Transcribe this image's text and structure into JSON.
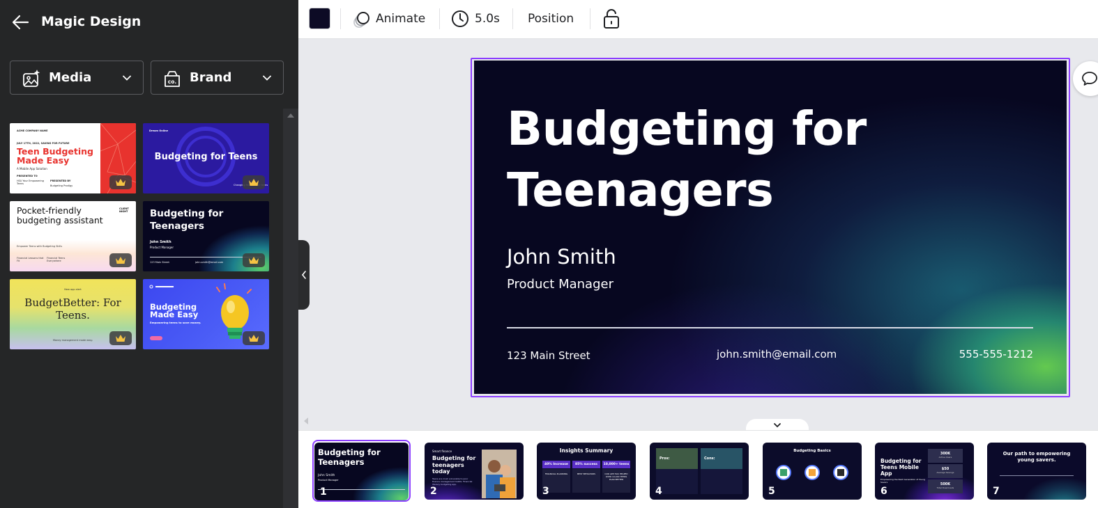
{
  "panel": {
    "title": "Magic Design",
    "filters": {
      "media_label": "Media",
      "brand_label": "Brand",
      "brand_logo_text": "co."
    }
  },
  "templates": [
    {
      "id": "t1",
      "small_top": "ACME COMPANY NAME",
      "date": "JULY 17TH, 2022, SAVING FOR FUTURE",
      "title": "Teen Budgeting Made Easy",
      "subtitle": "A Mobile App Solution",
      "presented_to_label": "PRESENTED TO",
      "presented_to": "HSU Your Empowering Teens",
      "presented_by_label": "PRESENTED BY",
      "presented_by": "Budgeting Prodigy"
    },
    {
      "id": "t2",
      "small_top": "Dream Online",
      "title": "Budgeting for Teens",
      "footer": "Changing finances for teens"
    },
    {
      "id": "t3",
      "title": "Pocket-friendly budgeting assistant",
      "corner": "CLIENT NIGHT",
      "tagline": "Empower Teens with Budgeting Skills",
      "col1_label": "Financial Lessons that Fit",
      "col2_label": "Financial Teens Everywhere"
    },
    {
      "id": "t4",
      "title": "Budgeting for Teenagers",
      "name": "John Smith",
      "role": "Product Manager",
      "addr": "123 Main Street",
      "mail": "john.smith@email.com"
    },
    {
      "id": "t5",
      "small_top": "New app alert",
      "title": "BudgetBetter: For Teens.",
      "footer": "Money management made easy."
    },
    {
      "id": "t6",
      "title": "Budgeting Made Easy",
      "subtitle": "Empowering teens to save money."
    }
  ],
  "toolbar": {
    "animate_label": "Animate",
    "duration_label": "5.0s",
    "position_label": "Position"
  },
  "slide": {
    "title": "Budgeting for Teenagers",
    "name": "John Smith",
    "role": "Product Manager",
    "address": "123 Main Street",
    "email": "john.smith@email.com",
    "phone": "555-555-1212"
  },
  "pages": [
    {
      "num": "1",
      "title": "Budgeting for Teenagers",
      "name": "John Smith",
      "role": "Product Manager"
    },
    {
      "num": "2",
      "kicker": "Smart finance",
      "title": "Budgeting for teenagers today",
      "body": "Teens are most vulnerable to poor finance management habits. Financial literacy budgeting app."
    },
    {
      "num": "3",
      "title": "Insights Summary",
      "stats": [
        "40% Increase",
        "85% success",
        "10,000+ teens"
      ],
      "labels": [
        "FINANCIAL PLANNING",
        "BEST BEHAVIORS",
        "OUR APP HAS HELPED OVER 10,000 TEENS PLAN BETTER"
      ]
    },
    {
      "num": "4",
      "pros": "Pros:",
      "cons": "Cons:"
    },
    {
      "num": "5",
      "title": "Budgeting Basics"
    },
    {
      "num": "6",
      "title": "Budgeting for Teens Mobile App",
      "sub": "Empowering the Next Generation of Young Savers",
      "stats": [
        "300K",
        "$50",
        "500K"
      ],
      "stat_labels": [
        "Active Users",
        "Average Savings",
        "Total Downloads"
      ]
    },
    {
      "num": "7",
      "title": "Our path to empowering young savers."
    }
  ]
}
